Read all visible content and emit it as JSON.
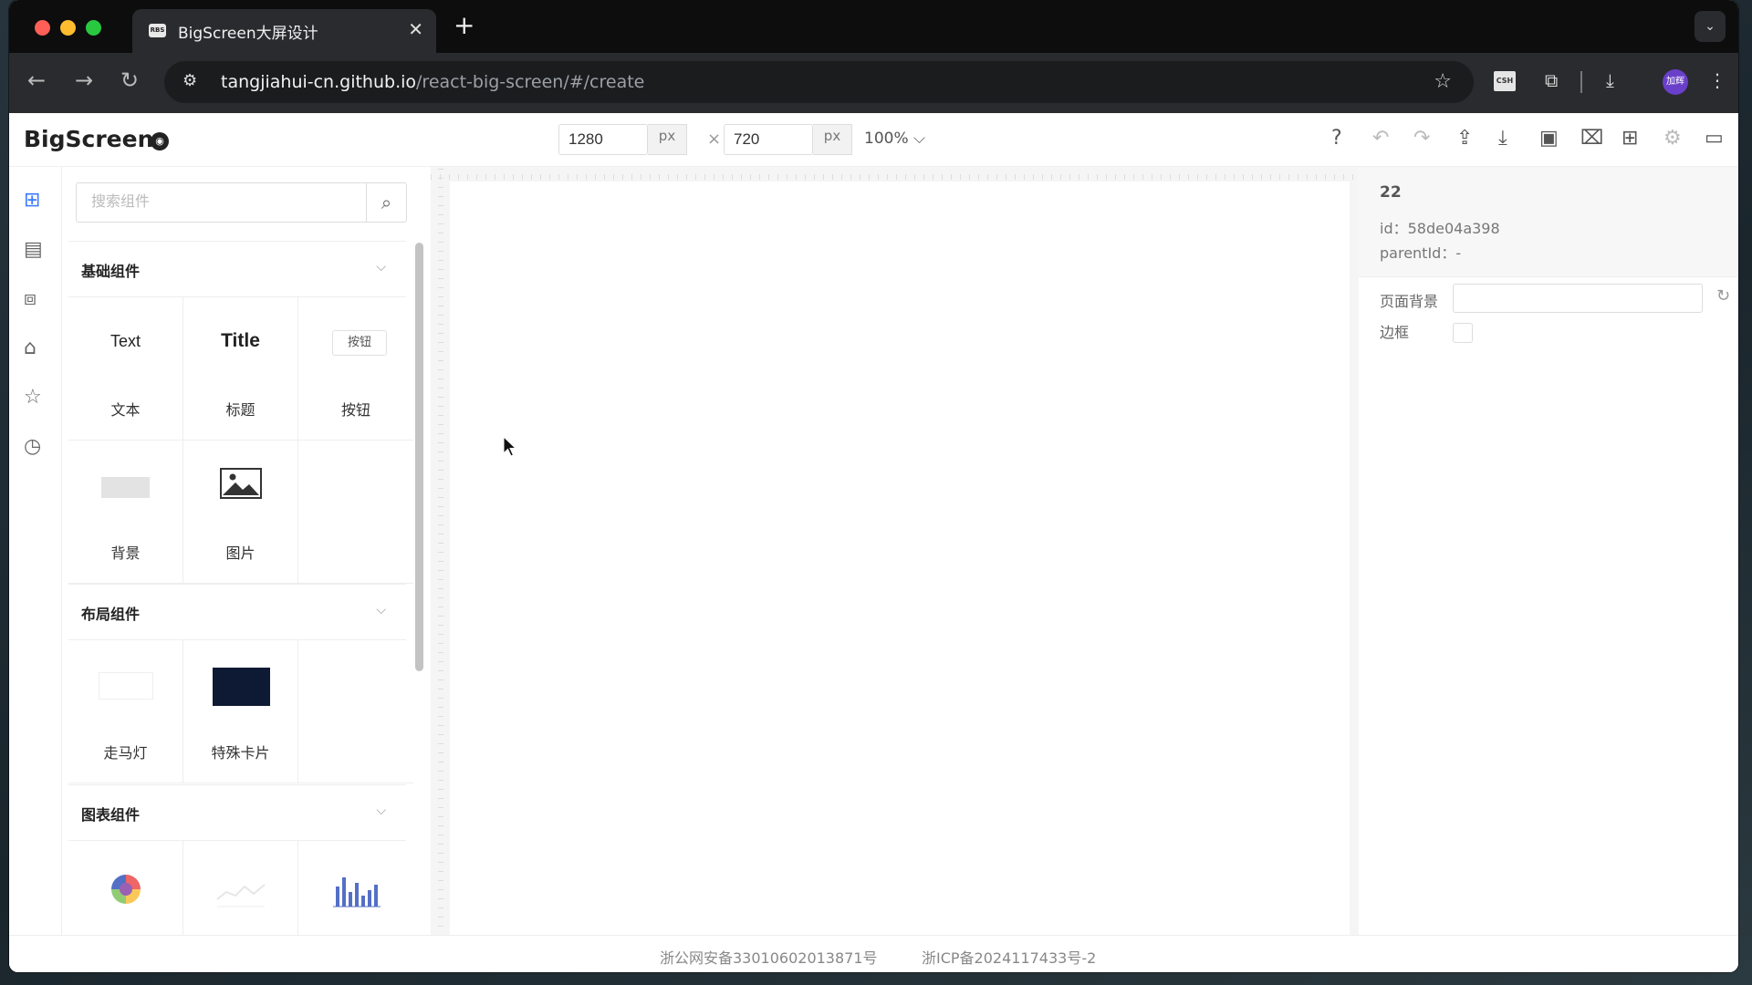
{
  "browser": {
    "tab_title": "BigScreen大屏设计",
    "tab_favicon": "RBS",
    "url_host": "tangjiahui-cn.github.io",
    "url_path": "/react-big-screen/#/create",
    "extension_label": "CSH",
    "profile_label": "加辉"
  },
  "header": {
    "logo": "BigScreen",
    "width_value": "1280",
    "height_value": "720",
    "unit": "px",
    "times_symbol": "×",
    "zoom": "100%"
  },
  "search": {
    "placeholder": "搜索组件"
  },
  "sections": {
    "basic": {
      "title": "基础组件",
      "text_preview": "Text",
      "text_label": "文本",
      "title_preview": "Title",
      "title_label": "标题",
      "button_preview": "按钮",
      "button_label": "按钮",
      "background_label": "背景",
      "image_label": "图片"
    },
    "layout": {
      "title": "布局组件",
      "marquee_label": "走马灯",
      "card_label": "特殊卡片"
    },
    "chart": {
      "title": "图表组件"
    }
  },
  "props": {
    "name": "22",
    "id_line": "id：58de04a398",
    "parent_line": "parentId：-",
    "background_label": "页面背景",
    "border_label": "边框"
  },
  "footer": {
    "gongan": "浙公网安备33010602013871号",
    "icp": "浙ICP备2024117433号-2"
  },
  "colors": {
    "accent": "#3a7afe",
    "card_dark": "#0e1a33"
  }
}
